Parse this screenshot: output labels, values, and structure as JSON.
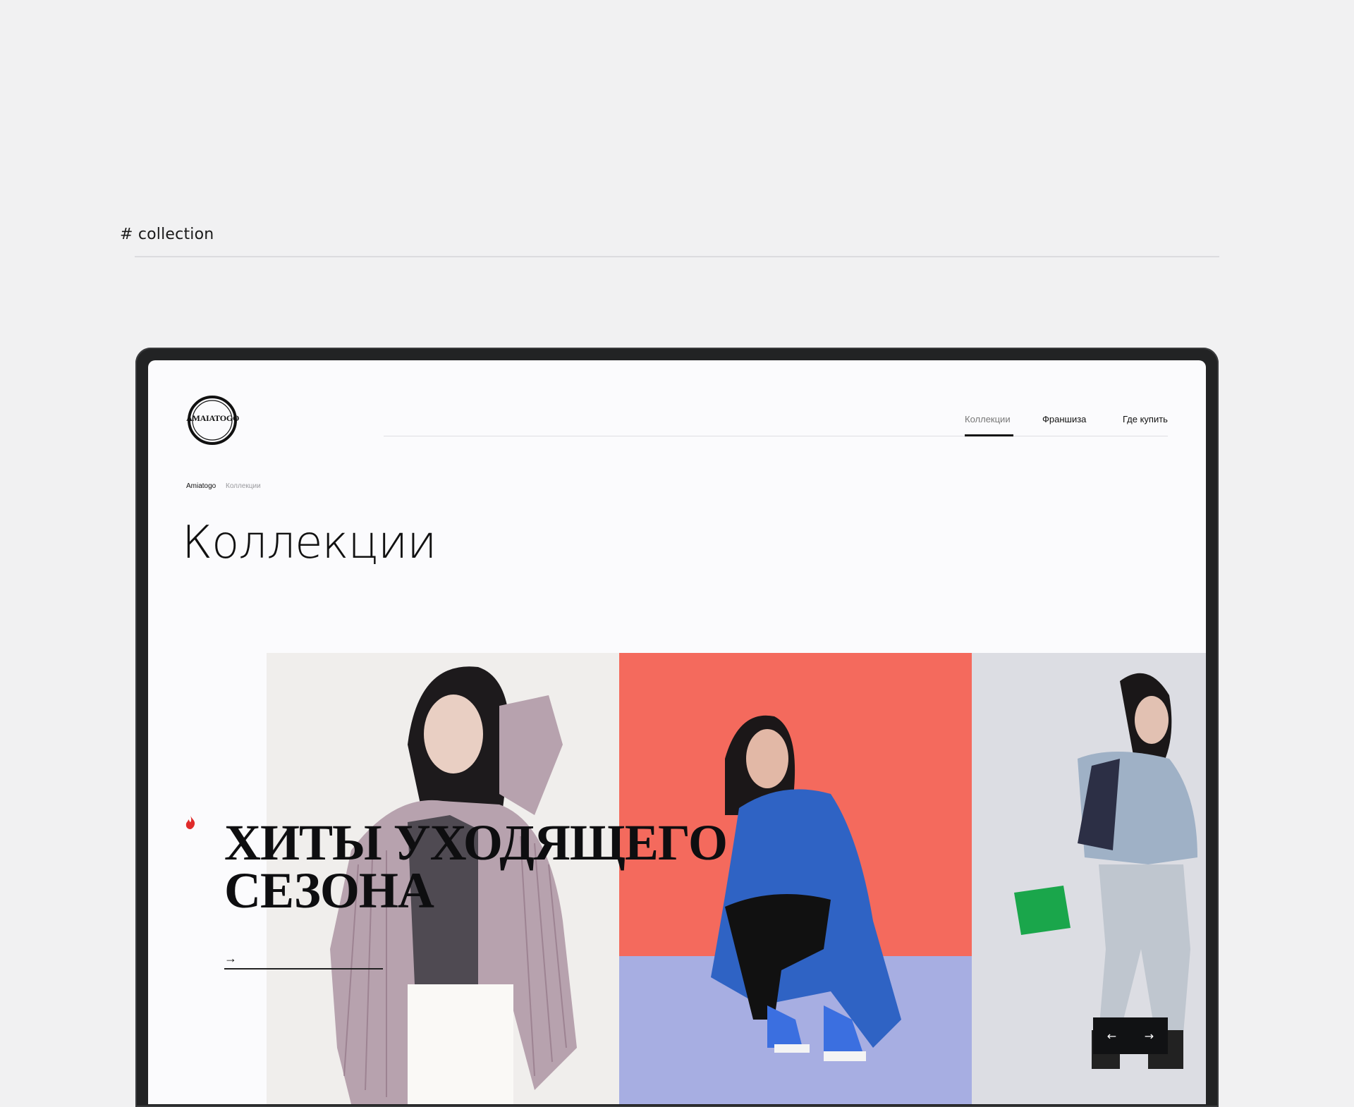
{
  "section": {
    "label": "# collection"
  },
  "header": {
    "logo_text": "AMAIATOGO",
    "nav": [
      {
        "label": "Коллекции",
        "active": true
      },
      {
        "label": "Франшиза",
        "active": false
      },
      {
        "label": "Где купить",
        "active": false
      }
    ]
  },
  "breadcrumb": {
    "home": "Amiatogo",
    "current": "Коллекции"
  },
  "page": {
    "title": "Коллекции"
  },
  "hero": {
    "title": "ХИТЫ УХОДЯЩЕГО\nСЕЗОНА",
    "arrow": "→",
    "accent_color": "#e02b2b"
  },
  "slider": {
    "prev": "←",
    "next": "→"
  },
  "colors": {
    "background": "#f1f1f2",
    "device_frame": "#222324",
    "photo2_backdrop": "#f46a5d",
    "photo2_floor": "#a7aee2"
  }
}
